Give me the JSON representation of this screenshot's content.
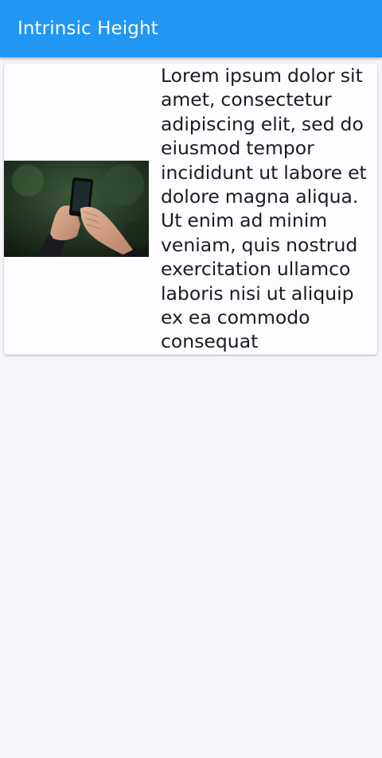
{
  "app_bar": {
    "title": "Intrinsic Height",
    "color": "#2196f3"
  },
  "card": {
    "image": {
      "icon": "photo-hands-holding-smartphone"
    },
    "text": "Lorem ipsum dolor sit amet, consectetur adipiscing elit, sed do eiusmod tempor incididunt ut labore et dolore magna aliqua. Ut enim ad minim veniam, quis nostrud exercitation ullamco laboris nisi ut aliquip ex ea commodo consequat"
  }
}
